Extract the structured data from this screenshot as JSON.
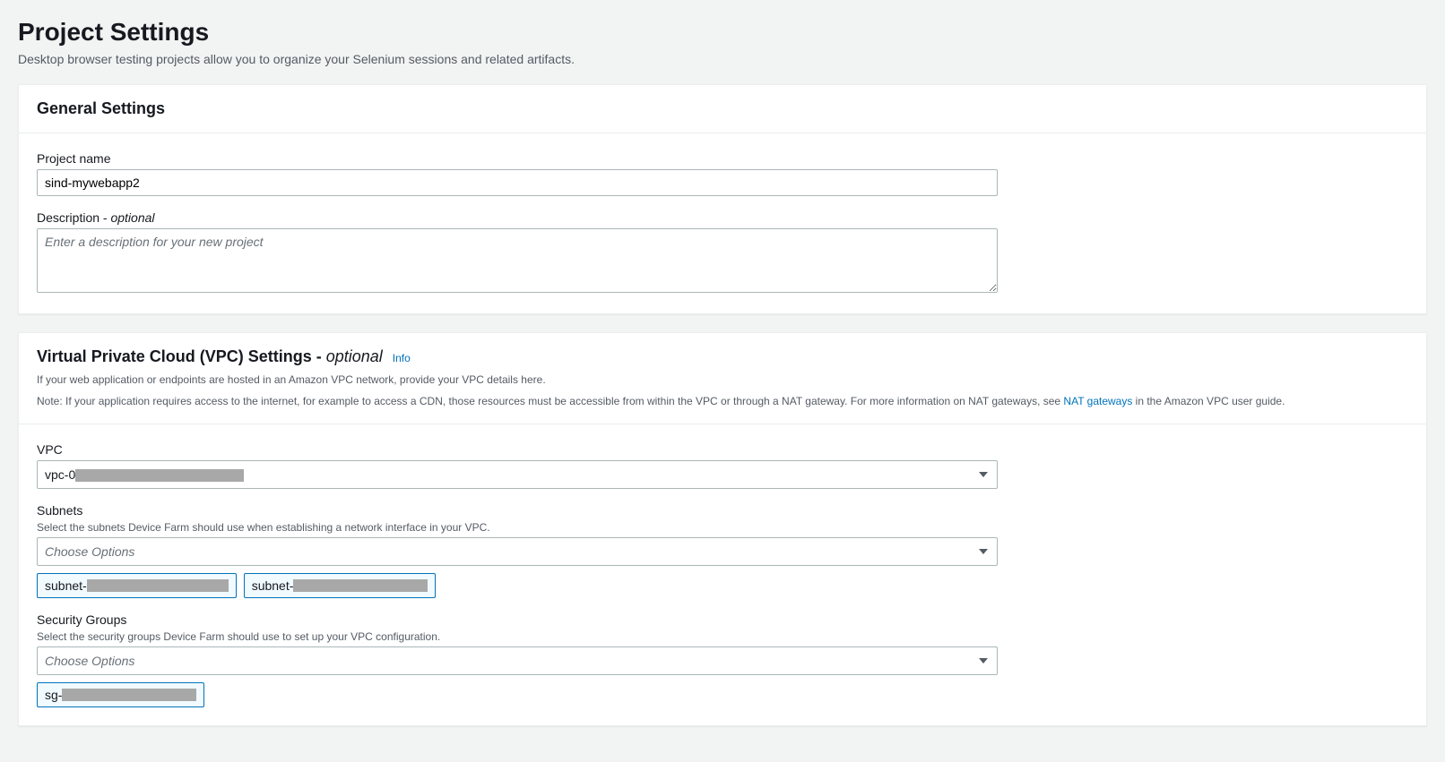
{
  "page": {
    "title": "Project Settings",
    "subtitle": "Desktop browser testing projects allow you to organize your Selenium sessions and related artifacts."
  },
  "general": {
    "heading": "General Settings",
    "projectName": {
      "label": "Project name",
      "value": "sind-mywebapp2"
    },
    "description": {
      "label": "Description - ",
      "optional": "optional",
      "placeholder": "Enter a description for your new project",
      "value": ""
    }
  },
  "vpc": {
    "heading": "Virtual Private Cloud (VPC) Settings - ",
    "headingOptional": "optional",
    "infoLink": "Info",
    "desc1": "If your web application or endpoints are hosted in an Amazon VPC network, provide your VPC details here.",
    "desc2a": "Note: If your application requires access to the internet, for example to access a CDN, those resources must be accessible from within the VPC or through a NAT gateway. For more information on NAT gateways, see ",
    "desc2link": "NAT gateways",
    "desc2b": " in the Amazon VPC user guide.",
    "vpcField": {
      "label": "VPC",
      "valuePrefix": "vpc-0"
    },
    "subnets": {
      "label": "Subnets",
      "hint": "Select the subnets Device Farm should use when establishing a network interface in your VPC.",
      "placeholder": "Choose Options",
      "chip1Prefix": "subnet-",
      "chip2Prefix": "subnet-"
    },
    "securityGroups": {
      "label": "Security Groups",
      "hint": "Select the security groups Device Farm should use to set up your VPC configuration.",
      "placeholder": "Choose Options",
      "chip1Prefix": "sg-"
    }
  }
}
